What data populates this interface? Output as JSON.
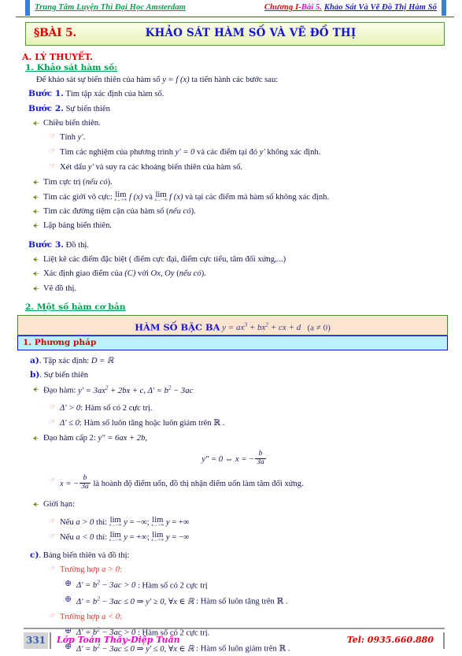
{
  "header": {
    "left": "Trung Tâm Luyện Thi Đại Học Amsterdam",
    "right_chuong": "Chương I-",
    "right_bai": "Bài 5.",
    "right_title": "Khảo Sát Và Vẽ Đồ Thị Hàm Số"
  },
  "banner": {
    "lesson_label": "§BÀI 5.",
    "title": "KHẢO SÁT HÀM SỐ VÀ VẼ ĐỒ THỊ"
  },
  "sections": {
    "a_heading": "A. LÝ THUYẾT.",
    "s1_heading": "1. Khảo sát hàm số:",
    "s1_intro_pre": "Để khảo sát sự biến thiên của hàm số ",
    "s1_intro_f": "y = f (x)",
    "s1_intro_post": " ta tiến hành các bước sau:",
    "step1_label": "Bước 1.",
    "step1_text": " Tìm tập xác định của hàm số.",
    "step2_label": "Bước 2.",
    "step2_text": " Sự biến thiên",
    "step3_label": "Bước 3.",
    "step3_text": " Đồ thị.",
    "b21": "Chiều biến thiên.",
    "b21a_pre": "Tính ",
    "b21a_f": "y'",
    "b21a_post": ".",
    "b21b_pre": "Tìm các nghiệm của phương trình ",
    "b21b_f1": "y' = 0",
    "b21b_mid": " và các điểm tại đó ",
    "b21b_f2": "y'",
    "b21b_post": " không xác định.",
    "b21c_pre": "Xét dấu ",
    "b21c_f": "y'",
    "b21c_post": " và suy ra các khoảng biến thiên của hàm số.",
    "b22_pre": "Tìm cực trị (",
    "b22_em": "nếu có",
    "b22_post": ").",
    "b23_pre": "Tìm các giới vô cực: ",
    "b23_post": " và tại các điểm mà hàm số không xác định.",
    "b23_and": " và ",
    "b24_pre": "Tìm các đường tiệm cận của hàm số (",
    "b24_em": "nếu có",
    "b24_post": ").",
    "b25": "Lập bảng biến thiên.",
    "b31": "Liệt kê các điểm đặc biệt ( điểm cực đại, điểm cực tiểu, tâm đối xứng,...)",
    "b32_pre": "Xác định giao điểm của ",
    "b32_f1": "(C)",
    "b32_mid": " với ",
    "b32_f2": "Ox, Oy",
    "b32_open": " (",
    "b32_em": "nếu có",
    "b32_post": ").",
    "b33": "Vẽ đồ thị.",
    "s2_heading": "2. Một số hàm cơ bản"
  },
  "formula_banner": {
    "name": "HÀM SỐ BẬC BA",
    "formula": "y = ax³ + bx² + cx + d",
    "condition": "(a ≠ 0)"
  },
  "method_bar": {
    "label": "1.  Phương pháp"
  },
  "method": {
    "a_label": "a)",
    "a_text": ". Tập xác định: ",
    "a_formula": "D = ℝ",
    "b_label": "b)",
    "b_text": ". Sự biến thiên",
    "deriv1_pre": "Đạo hàm: ",
    "deriv1_f1": "y' = 3ax² + 2bx + c",
    "deriv1_mid": ", ",
    "deriv1_f2": "Δ' = b² − 3ac",
    "case1_f": "Δ' > 0",
    "case1_text": ": Hàm số có 2 cực trị.",
    "case2_f": "Δ' ≤ 0",
    "case2_text": ": Hàm số luôn tăng hoặc luôn giảm trên ℝ .",
    "deriv2_pre": "Đạo hàm cấp 2: ",
    "deriv2_f": "y\" = 6ax + 2b",
    "deriv2_post": ",",
    "centered_eq_lhs": "y\" = 0 ⇔ x = −",
    "centered_eq_num": "b",
    "centered_eq_den": "3a",
    "inflect_lhs": "x = −",
    "inflect_num": "b",
    "inflect_den": "3a",
    "inflect_text": " là hoành độ điểm uốn, đồ thị nhận điểm uốn làm tâm đối xứng.",
    "limit_label": "Giới hạn:",
    "lim_pos_pre": "Nếu ",
    "lim_pos_cond": "a > 0",
    "lim_pos_then": " thì: ",
    "lim_neg_cond": "a < 0",
    "lim_sub_minus": "x→−∞",
    "lim_sub_plus": "x→+∞",
    "lim_op": "lim",
    "lim_y": "y",
    "val_neg_inf": "= −∞;",
    "val_pos_inf": "= +∞",
    "val_pos_inf2": "= +∞;",
    "val_neg_inf2": "= −∞",
    "c_label": "c)",
    "c_text": ". Bảng biến thiên và đồ thị:",
    "case_pos_pre": "Trường hợp ",
    "case_pos_cond": "a > 0",
    "case_pos_colon": ":",
    "case_neg_cond": "a < 0",
    "pos_item1_f": "Δ' = b² − 3ac > 0",
    "pos_item1_t": " : Hàm số có 2 cực trị",
    "pos_item2_f": "Δ' = b² − 3ac ≤ 0 ⇒ y' ≥ 0, ∀x ∈ ℝ",
    "pos_item2_t": " : Hàm số luôn tăng trên ℝ .",
    "neg_item1_f": "Δ' = b² − 3ac > 0",
    "neg_item1_t": " : Hàm số có 2 cực trị.",
    "neg_item2_f": "Δ' = b² − 3ac ≤ 0 ⇒ y' ≤ 0, ∀x ∈ ℝ",
    "neg_item2_t": " : Hàm số luôn giảm trên ℝ ."
  },
  "footer": {
    "page": "331",
    "left": "Lớp Toán Thầy-Diệp Tuấn",
    "right": "Tel: 0935.660.880"
  },
  "icons": {
    "bullet1": "leaf-arrow-icon",
    "bullet2": "pointing-hand-icon",
    "bullet3": "circled-plus-icon"
  }
}
